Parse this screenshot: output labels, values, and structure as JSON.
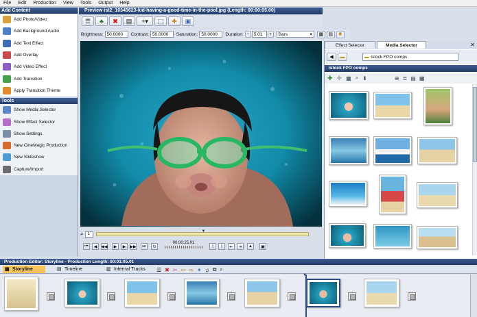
{
  "menu": [
    "File",
    "Edit",
    "Production",
    "View",
    "Tools",
    "Output",
    "Help"
  ],
  "add_content": {
    "title": "Add Content",
    "items": [
      {
        "label": "Add Photo/Video",
        "icon": "photo-video-icon",
        "color": "#d9a23a"
      },
      {
        "label": "Add Background Audio",
        "icon": "audio-icon",
        "color": "#4a7fc9"
      },
      {
        "label": "Add Text Effect",
        "icon": "text-effect-icon",
        "color": "#3e6db8"
      },
      {
        "label": "Add Overlay",
        "icon": "overlay-icon",
        "color": "#cc4a4a"
      },
      {
        "label": "Add Video Effect",
        "icon": "video-effect-icon",
        "color": "#8a5fc0"
      },
      {
        "label": "Add Transition",
        "icon": "transition-icon",
        "color": "#44a34a"
      },
      {
        "label": "Apply Transition Theme",
        "icon": "transition-theme-icon",
        "color": "#e08a2c"
      }
    ]
  },
  "tools": {
    "title": "Tools",
    "items": [
      {
        "label": "Show Media Selector",
        "icon": "media-selector-icon",
        "color": "#5b86c4"
      },
      {
        "label": "Show Effect Selector",
        "icon": "effect-selector-icon",
        "color": "#b46fc4"
      },
      {
        "label": "Show Settings",
        "icon": "settings-icon",
        "color": "#7d8da6"
      },
      {
        "label": "New CineMagic Production",
        "icon": "cinemagic-icon",
        "color": "#d96b2c"
      },
      {
        "label": "New Slideshow",
        "icon": "slideshow-icon",
        "color": "#4b9bd6"
      },
      {
        "label": "Capture/Import",
        "icon": "capture-icon",
        "color": "#6d6d6d"
      }
    ]
  },
  "preview": {
    "title": "Preview   ist2_10345623-kid-having-a-good-time-in-the-pool.jpg (Length: 00:00:05.00)",
    "brightness_label": "Brightness:",
    "brightness": "50.0000",
    "contrast_label": "Contrast:",
    "contrast": "50.0000",
    "saturation_label": "Saturation:",
    "saturation": "50.0000",
    "duration_label": "Duration:",
    "duration": "5.01",
    "bars_value": "Bars",
    "zoom": "1",
    "timecode": "00:00:25.01"
  },
  "media_selector": {
    "tab_effect": "Effect Selector",
    "tab_media": "Media Selector",
    "folder": "istock FPO comps",
    "section_title": "istock FPO comps"
  },
  "production": {
    "title": "Production Editor: Storyline - Production Length: 00:01:05.01",
    "tab_storyline": "Storyline",
    "tab_timeline": "Timeline",
    "tab_internal": "Internal Tracks"
  }
}
